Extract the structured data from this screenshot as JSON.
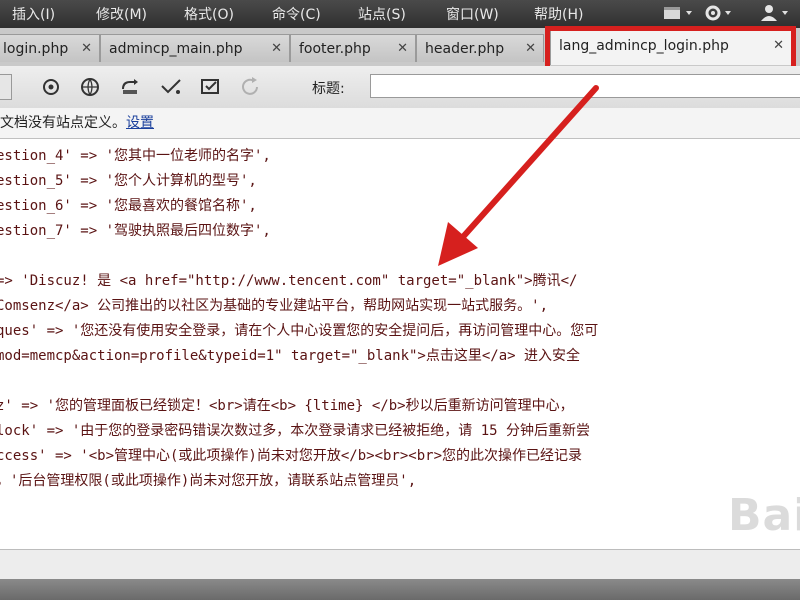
{
  "menu": {
    "items": [
      "插入(I)",
      "修改(M)",
      "格式(O)",
      "命令(C)",
      "站点(S)",
      "窗口(W)",
      "帮助(H)"
    ]
  },
  "tabs": [
    {
      "label": "login.php"
    },
    {
      "label": "admincp_main.php"
    },
    {
      "label": "footer.php"
    },
    {
      "label": "header.php"
    },
    {
      "label": "lang_admincp_login.php",
      "active": true
    }
  ],
  "toolbar": {
    "title_label": "标题:",
    "title_value": ""
  },
  "infobar": {
    "text": "文档没有站点定义。",
    "link": "设置"
  },
  "code_lines": [
    "estion_4' => '您其中一位老师的名字',",
    "estion_5' => '您个人计算机的型号',",
    "estion_6' => '您最喜欢的餐馆名称',",
    "estion_7' => '驾驶执照最后四位数字',",
    "",
    "=> 'Discuz! 是 <a href=\"http://www.tencent.com\" target=\"_blank\">腾讯</",
    "Comsenz</a> 公司推出的以社区为基础的专业建站平台，帮助网站实现一站式服务。',",
    "ques' => '您还没有使用安全登录，请在个人中心设置您的安全提问后，再访问管理中心。您可",
    "mod=memcp&action=profile&typeid=1\" target=\"_blank\">点击这里</a> 进入安全",
    "",
    "z' => '您的管理面板已经锁定！<br>请在<b> {ltime} </b>秒以后重新访问管理中心，",
    "lock' => '由于您的登录密码错误次数过多，本次登录请求已经被拒绝，请 15 分钟后重新尝",
    "ccess' => '<b>管理中心(或此项操作)尚未对您开放</b><br><br>您的此次操作已经记录",
    "，'后台管理权限(或此项操作)尚未对您开放，请联系站点管理员',"
  ],
  "watermark": "Bai"
}
